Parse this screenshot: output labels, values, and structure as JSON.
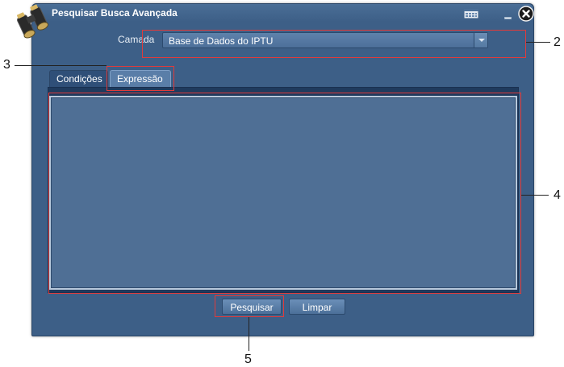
{
  "window": {
    "title": "Pesquisar Busca Avançada"
  },
  "icons": {
    "app": "binoculars-icon",
    "calendar": "calendar-icon",
    "minimize": "minimize-icon",
    "close": "close-icon"
  },
  "layer": {
    "label": "Camada",
    "selected": "Base de Dados do IPTU"
  },
  "tabs": [
    {
      "label": "Condições",
      "active": false
    },
    {
      "label": "Expressão",
      "active": true
    }
  ],
  "expression": {
    "value": ""
  },
  "buttons": {
    "search": "Pesquisar",
    "clear": "Limpar"
  },
  "annotations": [
    "2",
    "3",
    "4",
    "5"
  ],
  "colors": {
    "window_bg": "#3d5f87",
    "annotation_red": "#e03b3b"
  }
}
